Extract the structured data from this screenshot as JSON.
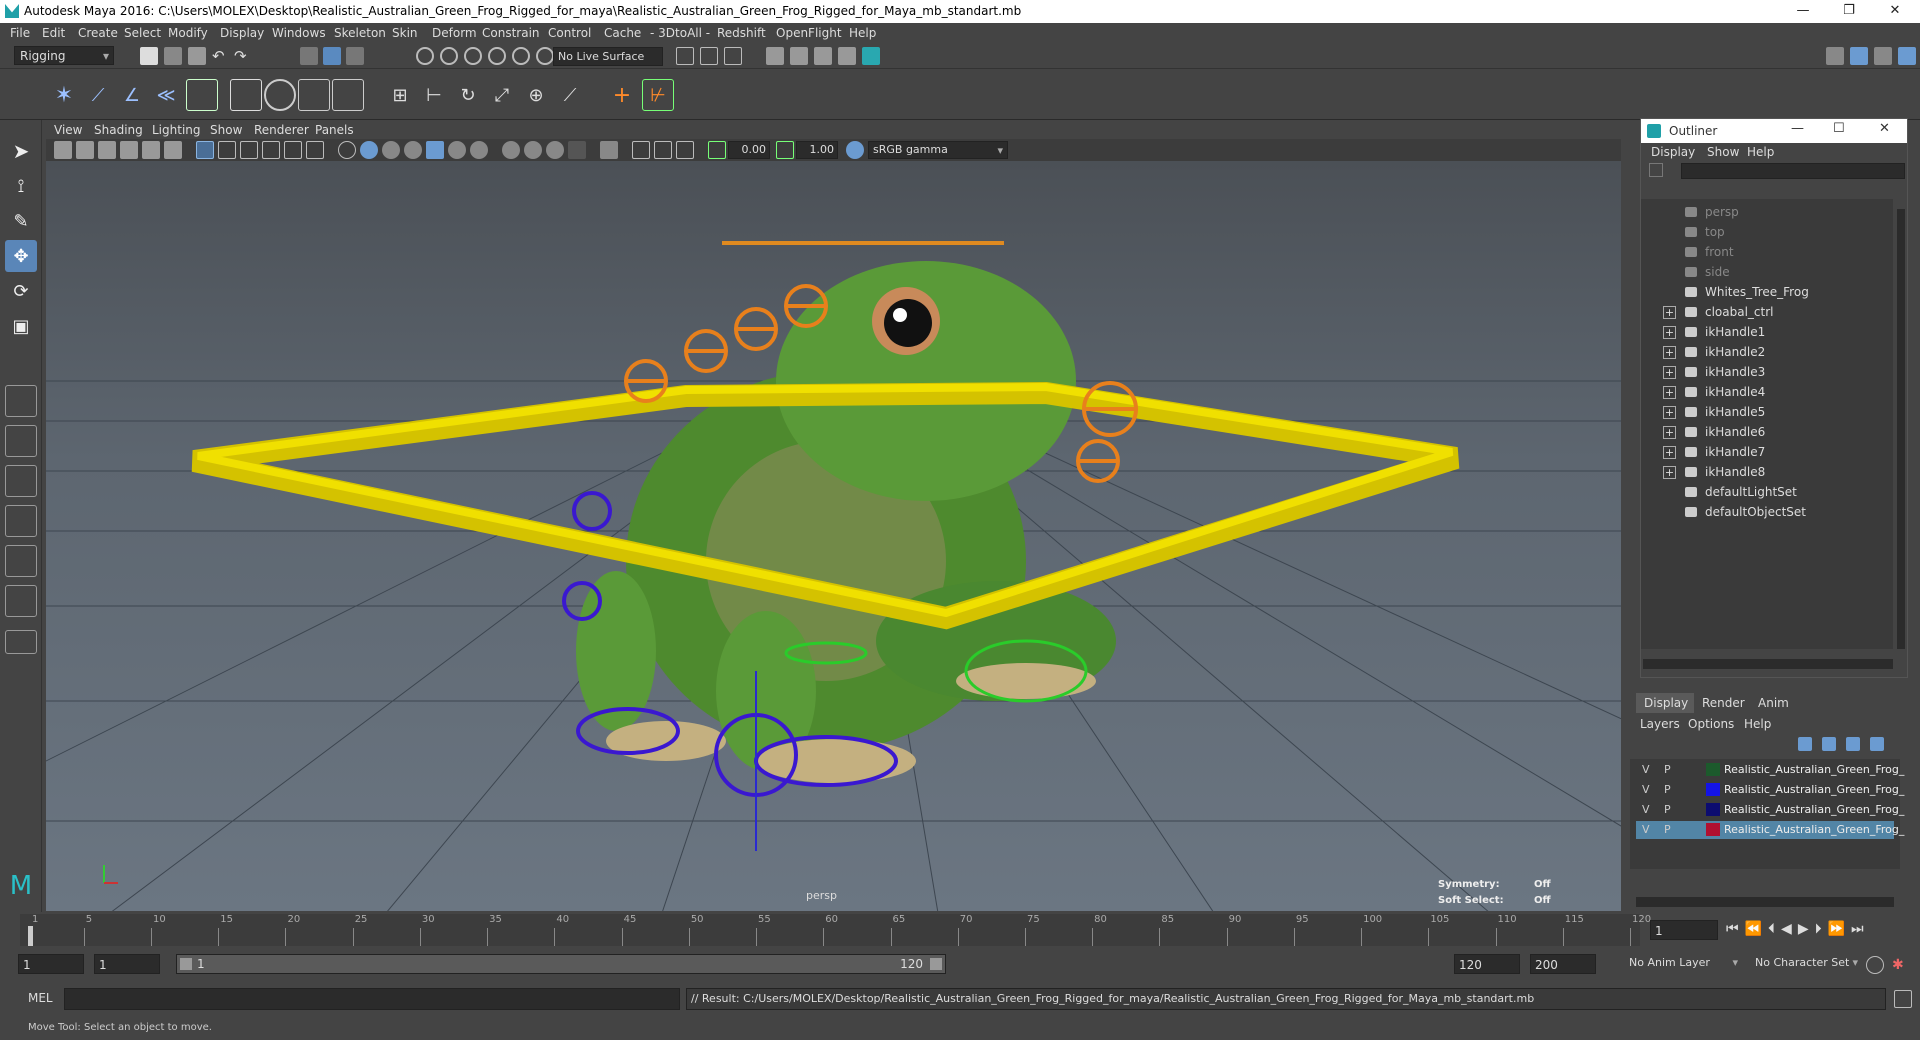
{
  "title_bar": {
    "text": "Autodesk Maya 2016: C:\\Users\\MOLEX\\Desktop\\Realistic_Australian_Green_Frog_Rigged_for_maya\\Realistic_Australian_Green_Frog_Rigged_for_Maya_mb_standart.mb"
  },
  "menu": [
    "File",
    "Edit",
    "Create",
    "Select",
    "Modify",
    "Display",
    "Windows",
    "Skeleton",
    "Skin",
    "Deform",
    "Constrain",
    "Control",
    "Cache",
    "- 3DtoAll -",
    "Redshift",
    "OpenFlight",
    "Help"
  ],
  "status_line": {
    "mode": "Rigging",
    "live_surface": "No Live Surface"
  },
  "viewport": {
    "menu": [
      "View",
      "Shading",
      "Lighting",
      "Show",
      "Renderer",
      "Panels"
    ],
    "field_a": "0.00",
    "field_b": "1.00",
    "color_space": "sRGB gamma",
    "camera_label": "persp",
    "symmetry_label": "Symmetry:",
    "symmetry_value": "Off",
    "soft_select_label": "Soft Select:",
    "soft_select_value": "Off"
  },
  "outliner": {
    "title": "Outliner",
    "menu": [
      "Display",
      "Show",
      "Help"
    ],
    "items": [
      {
        "label": "persp",
        "dim": true,
        "expandable": false
      },
      {
        "label": "top",
        "dim": true,
        "expandable": false
      },
      {
        "label": "front",
        "dim": true,
        "expandable": false
      },
      {
        "label": "side",
        "dim": true,
        "expandable": false
      },
      {
        "label": "Whites_Tree_Frog",
        "dim": false,
        "expandable": false
      },
      {
        "label": "cloabal_ctrl",
        "dim": false,
        "expandable": true
      },
      {
        "label": "ikHandle1",
        "dim": false,
        "expandable": true
      },
      {
        "label": "ikHandle2",
        "dim": false,
        "expandable": true
      },
      {
        "label": "ikHandle3",
        "dim": false,
        "expandable": true
      },
      {
        "label": "ikHandle4",
        "dim": false,
        "expandable": true
      },
      {
        "label": "ikHandle5",
        "dim": false,
        "expandable": true
      },
      {
        "label": "ikHandle6",
        "dim": false,
        "expandable": true
      },
      {
        "label": "ikHandle7",
        "dim": false,
        "expandable": true
      },
      {
        "label": "ikHandle8",
        "dim": false,
        "expandable": true
      },
      {
        "label": "defaultLightSet",
        "dim": false,
        "expandable": false
      },
      {
        "label": "defaultObjectSet",
        "dim": false,
        "expandable": false
      }
    ]
  },
  "layer_editor": {
    "tabs": [
      "Display",
      "Render",
      "Anim"
    ],
    "menu": [
      "Layers",
      "Options",
      "Help"
    ],
    "rows": [
      {
        "v": "V",
        "p": "P",
        "color": "#1c5a2c",
        "name": "Realistic_Australian_Green_Frog_",
        "selected": false
      },
      {
        "v": "V",
        "p": "P",
        "color": "#1414e6",
        "name": "Realistic_Australian_Green_Frog_",
        "selected": false
      },
      {
        "v": "V",
        "p": "P",
        "color": "#0c0c70",
        "name": "Realistic_Australian_Green_Frog_",
        "selected": false
      },
      {
        "v": "V",
        "p": "P",
        "color": "#b01030",
        "name": "Realistic_Australian_Green_Frog_",
        "selected": true
      }
    ]
  },
  "timeline": {
    "ticks": [
      "1",
      "5",
      "10",
      "15",
      "20",
      "25",
      "30",
      "35",
      "40",
      "45",
      "50",
      "55",
      "60",
      "65",
      "70",
      "75",
      "80",
      "85",
      "90",
      "95",
      "100",
      "105",
      "110",
      "115",
      "120"
    ],
    "current_frame": "1"
  },
  "range": {
    "start": "1",
    "start_inner": "1",
    "slider_start": "1",
    "slider_end": "120",
    "end_inner": "120",
    "end": "200",
    "anim_layer": "No Anim Layer",
    "character_set": "No Character Set"
  },
  "command_line": {
    "label": "MEL",
    "result": "// Result: C:/Users/MOLEX/Desktop/Realistic_Australian_Green_Frog_Rigged_for_maya/Realistic_Australian_Green_Frog_Rigged_for_Maya_mb_standart.mb"
  },
  "help_line": {
    "text": "Move Tool: Select an object to move."
  }
}
